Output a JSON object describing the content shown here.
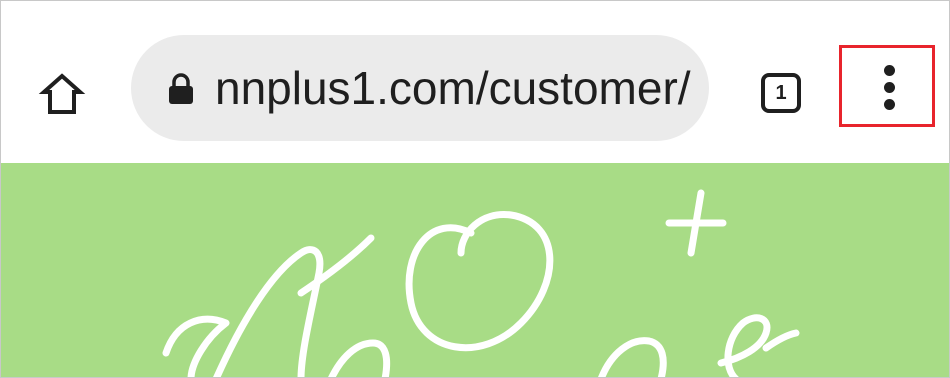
{
  "toolbar": {
    "home_icon": "home-icon",
    "url": "nnplus1.com/customer/",
    "lock_icon": "lock-icon",
    "tab_count": "1",
    "menu_icon": "more-vert-icon"
  },
  "page": {
    "background_color": "#a8dc86",
    "logo_text": "NnOne+"
  },
  "highlight": {
    "color": "#e8242c"
  }
}
